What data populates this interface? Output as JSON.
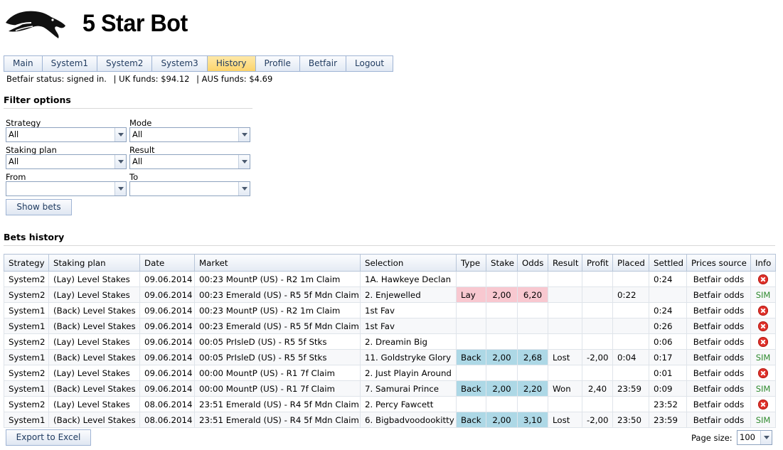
{
  "app": {
    "title": "5 Star Bot",
    "logo": "horse-head-logo"
  },
  "nav": {
    "items": [
      "Main",
      "System1",
      "System2",
      "System3",
      "History",
      "Profile",
      "Betfair",
      "Logout"
    ],
    "active": "History"
  },
  "status": {
    "betfair": "Betfair status: signed in.",
    "uk_funds": "| UK funds: $94.12",
    "aus_funds": "| AUS funds: $4.69"
  },
  "filters": {
    "title": "Filter options",
    "strategy": {
      "label": "Strategy",
      "value": "All"
    },
    "mode": {
      "label": "Mode",
      "value": "All"
    },
    "staking_plan": {
      "label": "Staking plan",
      "value": "All"
    },
    "result": {
      "label": "Result",
      "value": "All"
    },
    "from": {
      "label": "From",
      "value": ""
    },
    "to": {
      "label": "To",
      "value": ""
    },
    "show_button": "Show bets"
  },
  "history": {
    "title": "Bets history",
    "columns": [
      "Strategy",
      "Staking plan",
      "Date",
      "Market",
      "Selection",
      "Type",
      "Stake",
      "Odds",
      "Result",
      "Profit",
      "Placed",
      "Settled",
      "Prices source",
      "Info"
    ],
    "rows": [
      {
        "strategy": "System2",
        "plan": "(Lay) Level Stakes",
        "date": "09.06.2014",
        "market": "00:23 MountP (US) - R2 1m Claim",
        "selection": "1A. Hawkeye Declan",
        "type": "",
        "stake": "",
        "odds": "",
        "result": "",
        "profit": "",
        "placed": "",
        "settled": "0:24",
        "source": "Betfair odds",
        "info": "x-icon"
      },
      {
        "strategy": "System2",
        "plan": "(Lay) Level Stakes",
        "date": "09.06.2014",
        "market": "00:23 Emerald (US) - R5 5f Mdn Claim",
        "selection": "2. Enjewelled",
        "type": "Lay",
        "stake": "2,00",
        "odds": "6,20",
        "result": "",
        "profit": "",
        "placed": "0:22",
        "settled": "",
        "source": "Betfair odds",
        "info": "SIM"
      },
      {
        "strategy": "System1",
        "plan": "(Back) Level Stakes",
        "date": "09.06.2014",
        "market": "00:23 MountP (US) - R2 1m Claim",
        "selection": "1st Fav",
        "type": "",
        "stake": "",
        "odds": "",
        "result": "",
        "profit": "",
        "placed": "",
        "settled": "0:24",
        "source": "Betfair odds",
        "info": "x-icon"
      },
      {
        "strategy": "System1",
        "plan": "(Back) Level Stakes",
        "date": "09.06.2014",
        "market": "00:23 Emerald (US) - R5 5f Mdn Claim",
        "selection": "1st Fav",
        "type": "",
        "stake": "",
        "odds": "",
        "result": "",
        "profit": "",
        "placed": "",
        "settled": "0:26",
        "source": "Betfair odds",
        "info": "x-icon"
      },
      {
        "strategy": "System2",
        "plan": "(Lay) Level Stakes",
        "date": "09.06.2014",
        "market": "00:05 PrIsleD (US) - R5 5f Stks",
        "selection": "2. Dreamin Big",
        "type": "",
        "stake": "",
        "odds": "",
        "result": "",
        "profit": "",
        "placed": "",
        "settled": "0:06",
        "source": "Betfair odds",
        "info": "x-icon"
      },
      {
        "strategy": "System1",
        "plan": "(Back) Level Stakes",
        "date": "09.06.2014",
        "market": "00:05 PrIsleD (US) - R5 5f Stks",
        "selection": "11. Goldstryke Glory",
        "type": "Back",
        "stake": "2,00",
        "odds": "2,68",
        "result": "Lost",
        "profit": "-2,00",
        "placed": "0:04",
        "settled": "0:17",
        "source": "Betfair odds",
        "info": "SIM"
      },
      {
        "strategy": "System2",
        "plan": "(Lay) Level Stakes",
        "date": "09.06.2014",
        "market": "00:00 MountP (US) - R1 7f Claim",
        "selection": "2. Just Playin Around",
        "type": "",
        "stake": "",
        "odds": "",
        "result": "",
        "profit": "",
        "placed": "",
        "settled": "0:01",
        "source": "Betfair odds",
        "info": "x-icon"
      },
      {
        "strategy": "System1",
        "plan": "(Back) Level Stakes",
        "date": "09.06.2014",
        "market": "00:00 MountP (US) - R1 7f Claim",
        "selection": "7. Samurai Prince",
        "type": "Back",
        "stake": "2,00",
        "odds": "2,20",
        "result": "Won",
        "profit": "2,40",
        "placed": "23:59",
        "settled": "0:09",
        "source": "Betfair odds",
        "info": "SIM"
      },
      {
        "strategy": "System2",
        "plan": "(Lay) Level Stakes",
        "date": "08.06.2014",
        "market": "23:51 Emerald (US) - R4 5f Mdn Claim",
        "selection": "2. Percy Fawcett",
        "type": "",
        "stake": "",
        "odds": "",
        "result": "",
        "profit": "",
        "placed": "",
        "settled": "23:52",
        "source": "Betfair odds",
        "info": "x-icon"
      },
      {
        "strategy": "System1",
        "plan": "(Back) Level Stakes",
        "date": "08.06.2014",
        "market": "23:51 Emerald (US) - R4 5f Mdn Claim",
        "selection": "6. Bigbadvoodookitty",
        "type": "Back",
        "stake": "2,00",
        "odds": "3,10",
        "result": "Lost",
        "profit": "-2,00",
        "placed": "23:50",
        "settled": "23:59",
        "source": "Betfair odds",
        "info": "SIM"
      }
    ]
  },
  "footer": {
    "export_button": "Export to Excel",
    "page_size_label": "Page size:",
    "page_size": "100"
  },
  "colors": {
    "lay": "#f8c8d0",
    "back": "#add8e6",
    "loss": "#e02020",
    "win": "#2f8a2f",
    "active_tab": "#fbd36b"
  }
}
